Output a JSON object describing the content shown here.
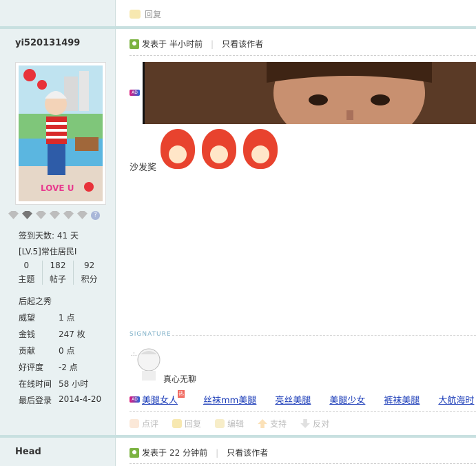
{
  "top": {
    "reply_label": "回复"
  },
  "post1": {
    "username": "yi520131499",
    "posted_label": "发表于",
    "posted_time": "半小时前",
    "author_only": "只看该作者",
    "avatar_text": "LOVE U",
    "checkin": "签到天数: 41 天",
    "level": "[LV.5]常住居民I",
    "stats": [
      {
        "num": "0",
        "label": "主题"
      },
      {
        "num": "182",
        "label": "帖子"
      },
      {
        "num": "92",
        "label": "积分"
      }
    ],
    "rank": "后起之秀",
    "info": [
      {
        "k": "威望",
        "v": "1 点"
      },
      {
        "k": "金钱",
        "v": "247 枚"
      },
      {
        "k": "贡献",
        "v": "0 点"
      },
      {
        "k": "好评度",
        "v": "-2 点"
      },
      {
        "k": "在线时间",
        "v": "58 小时"
      },
      {
        "k": "最后登录",
        "v": "2014-4-20"
      }
    ],
    "body_text": "沙发奖",
    "signature_label": "SIGNATURE",
    "signature_text": "真心无聊",
    "ad_badge": "AD",
    "links": [
      "美腿女人",
      "丝袜mm美腿",
      "亮丝美腿",
      "美腿少女",
      "裤袜美腿",
      "大航海时"
    ],
    "hot_badge": "热",
    "actions": [
      "点评",
      "回复",
      "编辑",
      "支持",
      "反对"
    ]
  },
  "post2": {
    "username": "Head",
    "posted_label": "发表于",
    "posted_time": "22 分钟前",
    "author_only": "只看该作者"
  }
}
